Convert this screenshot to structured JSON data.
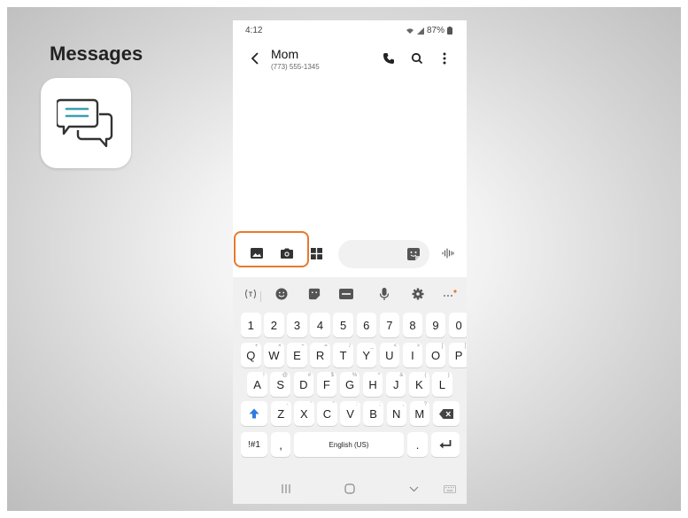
{
  "slide": {
    "title": "Messages",
    "app_icon": "chat-bubbles-icon"
  },
  "status_bar": {
    "time": "4:12",
    "battery": "87%",
    "icons": [
      "wifi-icon",
      "signal-icon",
      "battery-icon"
    ]
  },
  "conversation": {
    "contact_name": "Mom",
    "contact_number": "(773) 555-1345"
  },
  "header_icons": [
    "back-icon",
    "phone-icon",
    "search-icon",
    "more-icon"
  ],
  "compose": {
    "buttons": [
      "gallery-icon",
      "camera-icon",
      "apps-icon",
      "sticker-icon",
      "voice-icon"
    ]
  },
  "keyboard": {
    "toolbar": [
      "expand-toolbar-icon",
      "emoji-icon",
      "sticker-icon",
      "gif-icon",
      "mic-icon",
      "settings-icon",
      "more-icon"
    ],
    "number_row": [
      "1",
      "2",
      "3",
      "4",
      "5",
      "6",
      "7",
      "8",
      "9",
      "0"
    ],
    "row1": [
      {
        "k": "Q",
        "s": "+"
      },
      {
        "k": "W",
        "s": "×"
      },
      {
        "k": "E",
        "s": "÷"
      },
      {
        "k": "R",
        "s": "="
      },
      {
        "k": "T",
        "s": "/"
      },
      {
        "k": "Y",
        "s": "_"
      },
      {
        "k": "U",
        "s": "<"
      },
      {
        "k": "I",
        "s": ">"
      },
      {
        "k": "O",
        "s": "["
      },
      {
        "k": "P",
        "s": "]"
      }
    ],
    "row2": [
      {
        "k": "A",
        "s": "!"
      },
      {
        "k": "S",
        "s": "@"
      },
      {
        "k": "D",
        "s": "#"
      },
      {
        "k": "F",
        "s": "$"
      },
      {
        "k": "G",
        "s": "%"
      },
      {
        "k": "H",
        "s": "^"
      },
      {
        "k": "J",
        "s": "&"
      },
      {
        "k": "K",
        "s": "("
      },
      {
        "k": "L",
        "s": ")"
      }
    ],
    "row3": [
      {
        "k": "Z",
        "s": "-"
      },
      {
        "k": "X",
        "s": "'"
      },
      {
        "k": "C",
        "s": "\""
      },
      {
        "k": "V",
        "s": ":"
      },
      {
        "k": "B",
        "s": ";"
      },
      {
        "k": "N",
        "s": ","
      },
      {
        "k": "M",
        "s": "?"
      }
    ],
    "shift_icon": "shift-icon",
    "backspace_icon": "backspace-icon",
    "symbols_label": "!#1",
    "comma_label": ",",
    "space_label": "English (US)",
    "period_label": ".",
    "enter_icon": "enter-icon"
  },
  "navigation": [
    "recents-icon",
    "home-icon",
    "back-chevron-icon",
    "keyboard-icon"
  ],
  "colors": {
    "highlight": "#e8792e",
    "shift_blue": "#2e7be0",
    "icon_teal": "#3aa0b0"
  }
}
